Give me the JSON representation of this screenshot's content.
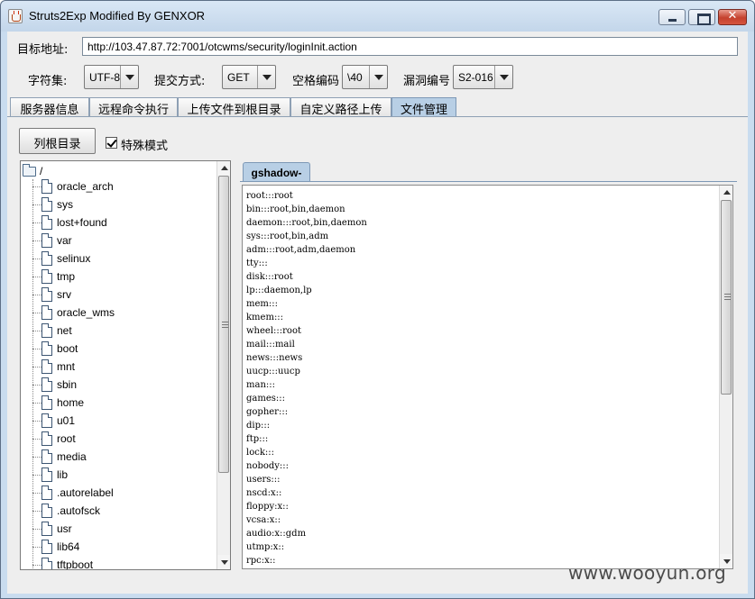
{
  "window": {
    "title": "Struts2Exp Modified By GENXOR",
    "close_glyph": "✕",
    "icons": [
      "java-app-icon",
      "minimize-icon",
      "maximize-icon",
      "close-icon"
    ]
  },
  "form": {
    "url_label": "目标地址:",
    "url_value": "http://103.47.87.72:7001/otcwms/security/loginInit.action",
    "charset_label": "字符集:",
    "charset_value": "UTF-8",
    "method_label": "提交方式:",
    "method_value": "GET",
    "space_label": "空格编码",
    "space_value": "\\40",
    "vuln_label": "漏洞编号",
    "vuln_value": "S2-016"
  },
  "tabs": [
    {
      "label": "服务器信息"
    },
    {
      "label": "远程命令执行"
    },
    {
      "label": "上传文件到根目录"
    },
    {
      "label": "自定义路径上传"
    },
    {
      "label": "文件管理",
      "active": true
    }
  ],
  "file_manager": {
    "list_root_button": "列根目录",
    "special_mode_label": "特殊模式",
    "special_mode_checked": true,
    "tree_root": "/",
    "tree_items": [
      "oracle_arch",
      "sys",
      "lost+found",
      "var",
      "selinux",
      "tmp",
      "srv",
      "oracle_wms",
      "net",
      "boot",
      "mnt",
      "sbin",
      "home",
      "u01",
      "root",
      "media",
      "lib",
      ".autorelabel",
      ".autofsck",
      "usr",
      "lib64",
      "tftpboot"
    ],
    "open_file_tab": "gshadow-",
    "file_lines": [
      "root:::root",
      "bin:::root,bin,daemon",
      "daemon:::root,bin,daemon",
      "sys:::root,bin,adm",
      "adm:::root,adm,daemon",
      "tty:::",
      "disk:::root",
      "lp:::daemon,lp",
      "mem:::",
      "kmem:::",
      "wheel:::root",
      "mail:::mail",
      "news:::news",
      "uucp:::uucp",
      "man:::",
      "games:::",
      "gopher:::",
      "dip:::",
      "ftp:::",
      "lock:::",
      "nobody:::",
      "users:::",
      "nscd:x::",
      "floppy:x::",
      "vcsa:x::",
      "audio:x::gdm",
      "utmp:x::",
      "rpc:x::"
    ]
  },
  "watermark": "www.wooyun.org",
  "colors": {
    "window_frame": "#c9dcef",
    "panel": "#eeeeee",
    "active_tab": "#b8cfe5",
    "close_button": "#c5412e"
  }
}
